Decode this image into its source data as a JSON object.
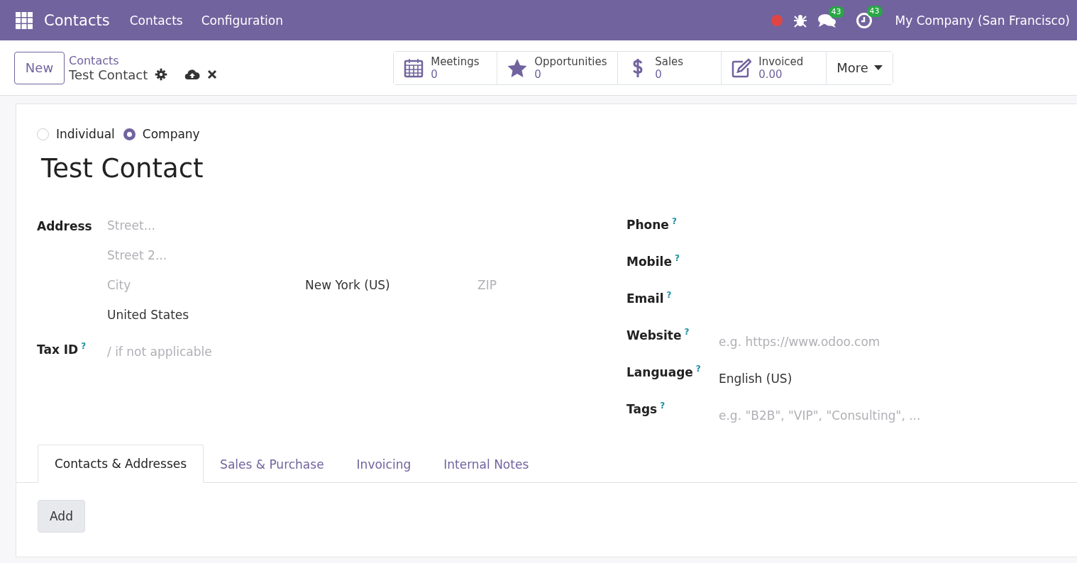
{
  "navbar": {
    "app_name": "Contacts",
    "menus": [
      "Contacts",
      "Configuration"
    ],
    "systray": [
      {
        "kind": "recording"
      },
      {
        "kind": "debug"
      },
      {
        "kind": "messages",
        "badge": "43"
      },
      {
        "kind": "activities",
        "badge": "43"
      },
      {
        "kind": "company",
        "label": "My Company (San Francisco)"
      }
    ]
  },
  "control_panel": {
    "new_button": "New",
    "breadcrumb": "Contacts",
    "record": "Test Contact",
    "stat_buttons": [
      {
        "kind": "calendar",
        "label": "Meetings",
        "value": "0"
      },
      {
        "kind": "star",
        "label": "Opportunities",
        "value": "0"
      },
      {
        "kind": "dollar",
        "label": "Sales",
        "value": "0"
      },
      {
        "kind": "edit",
        "label": "Invoiced",
        "value": "0.00"
      }
    ],
    "more": "More"
  },
  "form": {
    "company_type": [
      {
        "label": "Individual",
        "selected": false
      },
      {
        "label": "Company",
        "selected": true
      }
    ],
    "name": "Test Contact",
    "address": {
      "label": "Address",
      "street": {
        "placeholder": "Street..."
      },
      "street2": {
        "placeholder": "Street 2..."
      },
      "city": {
        "placeholder": "City"
      },
      "state": {
        "value": "New York (US)"
      },
      "zip": {
        "placeholder": "ZIP"
      },
      "country": {
        "value": "United States"
      }
    },
    "tax_id": {
      "label": "Tax ID",
      "help": "?",
      "placeholder": "/ if not applicable"
    },
    "right_fields": [
      {
        "label": "Phone",
        "help": "?"
      },
      {
        "label": "Mobile",
        "help": "?"
      },
      {
        "label": "Email",
        "help": "?"
      },
      {
        "label": "Website",
        "help": "?",
        "placeholder": "e.g. https://www.odoo.com"
      },
      {
        "label": "Language",
        "help": "?",
        "value": "English (US)"
      },
      {
        "label": "Tags",
        "help": "?",
        "placeholder": "e.g. \"B2B\", \"VIP\", \"Consulting\", ..."
      }
    ],
    "tabs": [
      {
        "label": "Contacts & Addresses",
        "selected": true
      },
      {
        "label": "Sales & Purchase",
        "selected": false
      },
      {
        "label": "Invoicing",
        "selected": false
      },
      {
        "label": "Internal Notes",
        "selected": false
      }
    ],
    "add_button": "Add"
  }
}
